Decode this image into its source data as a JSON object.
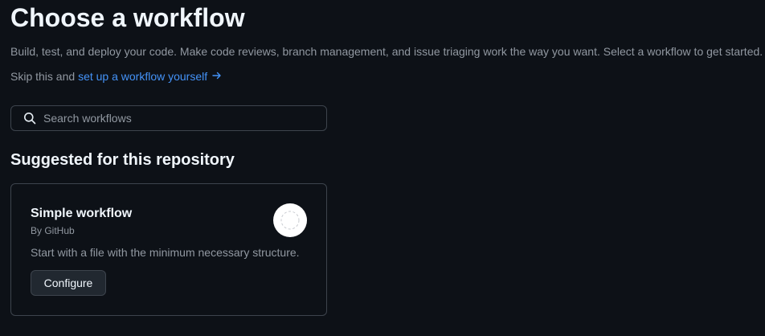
{
  "header": {
    "title": "Choose a workflow",
    "description": "Build, test, and deploy your code. Make code reviews, branch management, and issue triaging work the way you want. Select a workflow to get started.",
    "skip_prefix": "Skip this and",
    "skip_link": "set up a workflow yourself"
  },
  "search": {
    "placeholder": "Search workflows",
    "value": ""
  },
  "suggested": {
    "title": "Suggested for this repository",
    "cards": [
      {
        "title": "Simple workflow",
        "author": "By GitHub",
        "description": "Start with a file with the minimum necessary structure.",
        "button_label": "Configure",
        "icon": "dashed-circle-logo-icon"
      }
    ]
  },
  "colors": {
    "background": "#0d1117",
    "link": "#4493f8",
    "muted_text": "#9198a1",
    "border": "#3d444d",
    "button_bg": "#212830"
  }
}
